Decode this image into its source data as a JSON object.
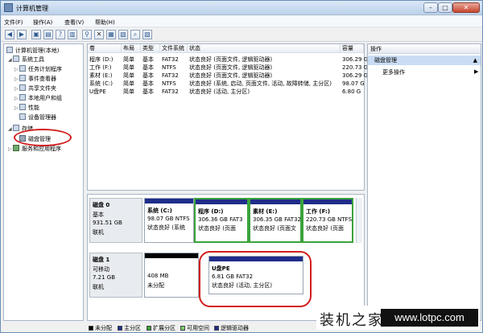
{
  "window": {
    "title": "计算机管理"
  },
  "menu": [
    "文件(F)",
    "操作(A)",
    "查看(V)",
    "帮助(H)"
  ],
  "tree": [
    {
      "label": "计算机管理(本地)",
      "level": 0,
      "icon": "computer-icon"
    },
    {
      "label": "系统工具",
      "level": 1,
      "icon": "tools-icon"
    },
    {
      "label": "任务计划程序",
      "level": 2,
      "icon": "clock-icon"
    },
    {
      "label": "事件查看器",
      "level": 2,
      "icon": "event-icon"
    },
    {
      "label": "共享文件夹",
      "level": 2,
      "icon": "folder-icon"
    },
    {
      "label": "本地用户和组",
      "level": 2,
      "icon": "users-icon"
    },
    {
      "label": "性能",
      "level": 2,
      "icon": "performance-icon"
    },
    {
      "label": "设备管理器",
      "level": 2,
      "icon": "device-icon"
    },
    {
      "label": "存储",
      "level": 1,
      "icon": "storage-icon"
    },
    {
      "label": "磁盘管理",
      "level": 2,
      "icon": "disk-icon"
    },
    {
      "label": "服务和应用程序",
      "level": 1,
      "icon": "services-icon"
    }
  ],
  "volumes": {
    "columns": [
      "卷",
      "布局",
      "类型",
      "文件系统",
      "状态",
      "容量"
    ],
    "rows": [
      [
        "程序 (D:)",
        "简单",
        "基本",
        "FAT32",
        "状态良好 (页面文件, 逻辑驱动器)",
        "306.29 G"
      ],
      [
        "工作 (F:)",
        "简单",
        "基本",
        "NTFS",
        "状态良好 (页面文件, 逻辑驱动器)",
        "220.73 G"
      ],
      [
        "素材 (E:)",
        "简单",
        "基本",
        "FAT32",
        "状态良好 (页面文件, 逻辑驱动器)",
        "306.29 G"
      ],
      [
        "系统 (C:)",
        "简单",
        "基本",
        "NTFS",
        "状态良好 (系统, 启动, 页面文件, 活动, 故障转储, 主分区)",
        "98.07 G"
      ],
      [
        "U盘PE",
        "简单",
        "基本",
        "FAT32",
        "状态良好 (活动, 主分区)",
        "6.80 G"
      ]
    ]
  },
  "disks": [
    {
      "name": "磁盘 0",
      "lines": [
        "基本",
        "931.51 GB",
        "联机"
      ],
      "partitions": [
        {
          "name": "系统 (C:)",
          "size": "98.07 GB NTFS",
          "status": "状态良好 (系统",
          "ext": false
        },
        {
          "name": "程序 (D:)",
          "size": "306.36 GB FAT3",
          "status": "状态良好 (页面",
          "ext": true
        },
        {
          "name": "素材 (E:)",
          "size": "306.35 GB FAT32",
          "status": "状态良好 (页面文",
          "ext": true
        },
        {
          "name": "工作 (F:)",
          "size": "220.73 GB NTFS",
          "status": "状态良好 (页面",
          "ext": true
        }
      ]
    },
    {
      "name": "磁盘 1",
      "lines": [
        "可移动",
        "7.21 GB",
        "联机"
      ],
      "partitions": [
        {
          "name": "",
          "size": "408 MB",
          "status": "未分配",
          "unallocated": true
        },
        {
          "name": "U盘PE",
          "size": "6.81 GB FAT32",
          "status": "状态良好 (活动, 主分区)"
        }
      ]
    }
  ],
  "legend": [
    {
      "label": "未分配",
      "color": "#000000"
    },
    {
      "label": "主分区",
      "color": "#1f2d8a"
    },
    {
      "label": "扩展分区",
      "color": "#3ba33b"
    },
    {
      "label": "可用空间",
      "color": "#7ccf6b"
    },
    {
      "label": "逻辑驱动器",
      "color": "#1f2d8a"
    }
  ],
  "actions": {
    "header": "操作",
    "selected": "磁盘管理",
    "more": "更多操作"
  },
  "watermark": {
    "cn": "装机之家",
    "url": "www.lotpc.com"
  },
  "colors": {
    "accent": "#1f2d8a",
    "extended": "#3ba33b",
    "highlight": "#d21d1d"
  }
}
